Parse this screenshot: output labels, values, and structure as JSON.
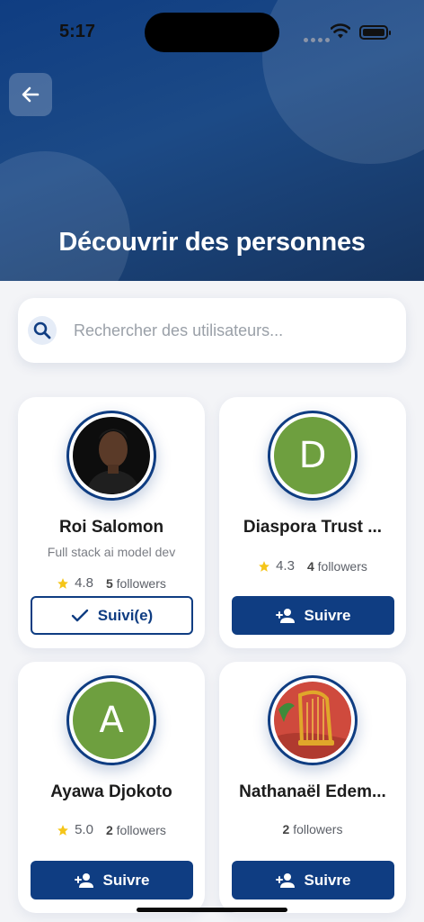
{
  "status": {
    "time": "5:17"
  },
  "header": {
    "title": "Découvrir des personnes"
  },
  "search": {
    "placeholder": "Rechercher des utilisateurs..."
  },
  "colors": {
    "primary": "#0f3d82",
    "star": "#f5c518",
    "avatar_green": "#6e9f3f"
  },
  "people": [
    {
      "name": "Roi Salomon",
      "bio": "Full stack ai model dev",
      "rating": "4.8",
      "followers_count": "5",
      "followers_label": "followers",
      "button": "Suivi(e)",
      "avatar": "photo"
    },
    {
      "name": "Diaspora Trust ...",
      "bio": "",
      "rating": "4.3",
      "followers_count": "4",
      "followers_label": "followers",
      "button": "Suivre",
      "avatar_letter": "D"
    },
    {
      "name": "Ayawa Djokoto",
      "bio": "",
      "rating": "5.0",
      "followers_count": "2",
      "followers_label": "followers",
      "button": "Suivre",
      "avatar_letter": "A"
    },
    {
      "name": "Nathanaël Edem...",
      "bio": "",
      "followers_count": "2",
      "followers_label": "followers",
      "button": "Suivre",
      "avatar": "harp-image"
    }
  ]
}
